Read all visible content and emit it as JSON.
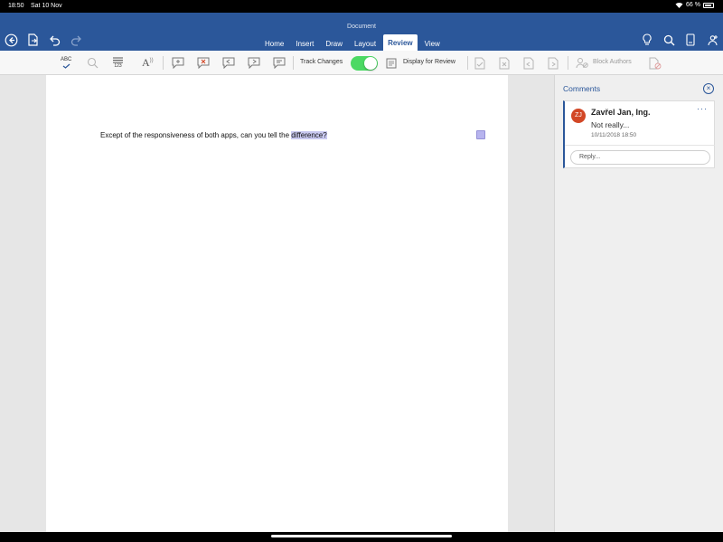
{
  "status": {
    "time": "18:50",
    "date": "Sat 10 Nov",
    "battery": "66 %"
  },
  "app": {
    "title": "Document"
  },
  "tabs": [
    {
      "label": "Home"
    },
    {
      "label": "Insert"
    },
    {
      "label": "Draw"
    },
    {
      "label": "Layout"
    },
    {
      "label": "Review",
      "active": true
    },
    {
      "label": "View"
    }
  ],
  "toolbar": {
    "spelling_label": "ABC",
    "word_count_label": "123",
    "track_changes_label": "Track Changes",
    "track_changes_on": true,
    "display_for_review_label": "Display for Review",
    "block_authors_label": "Block Authors"
  },
  "document": {
    "text_before": "Except of the responsiveness of both apps, can you tell the ",
    "text_selected": "difference?"
  },
  "comments": {
    "title": "Comments",
    "items": [
      {
        "initials": "ZJ",
        "author": "Zavřel Jan, Ing.",
        "text": "Not really...",
        "timestamp": "10/11/2018 18:50",
        "reply_placeholder": "Reply..."
      }
    ]
  },
  "colors": {
    "accent": "#2b579a",
    "avatar": "#d24726",
    "toggle_on": "#4cd964",
    "selection": "#c8c8ef"
  }
}
